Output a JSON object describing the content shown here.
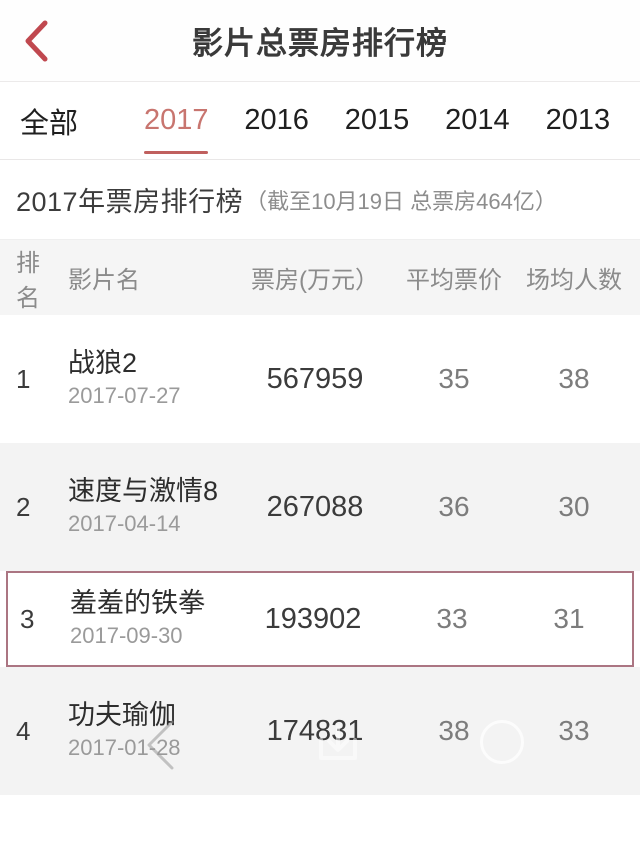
{
  "header": {
    "back_icon": "chevron-left-icon",
    "title": "影片总票房排行榜",
    "back_color": "#c0484f"
  },
  "tabs": {
    "active_index": 1,
    "accent_color": "#c0605e",
    "items": [
      {
        "label": "全部"
      },
      {
        "label": "2017"
      },
      {
        "label": "2016"
      },
      {
        "label": "2015"
      },
      {
        "label": "2014"
      },
      {
        "label": "2013"
      }
    ]
  },
  "subtitle": {
    "main": "2017年票房排行榜",
    "sub": "（截至10月19日 总票房464亿）"
  },
  "table": {
    "columns": {
      "rank": "排名",
      "name": "影片名",
      "box_office": "票房(万元）",
      "avg_price": "平均票价",
      "avg_attendance": "场均人数"
    },
    "highlight_color": "#ab7582",
    "rows": [
      {
        "rank": "1",
        "title": "战狼2",
        "date": "2017-07-27",
        "box_office": "567959",
        "avg_price": "35",
        "avg_attendance": "38",
        "shaded": false,
        "highlighted": false
      },
      {
        "rank": "2",
        "title": "速度与激情8",
        "date": "2017-04-14",
        "box_office": "267088",
        "avg_price": "36",
        "avg_attendance": "30",
        "shaded": true,
        "highlighted": false
      },
      {
        "rank": "3",
        "title": "羞羞的铁拳",
        "date": "2017-09-30",
        "box_office": "193902",
        "avg_price": "33",
        "avg_attendance": "31",
        "shaded": false,
        "highlighted": true
      },
      {
        "rank": "4",
        "title": "功夫瑜伽",
        "date": "2017-01-28",
        "box_office": "174831",
        "avg_price": "38",
        "avg_attendance": "33",
        "shaded": true,
        "highlighted": false
      }
    ]
  },
  "overlay_icons": [
    {
      "name": "chevron-left-icon"
    },
    {
      "name": "download-icon"
    },
    {
      "name": "circle-icon"
    }
  ]
}
